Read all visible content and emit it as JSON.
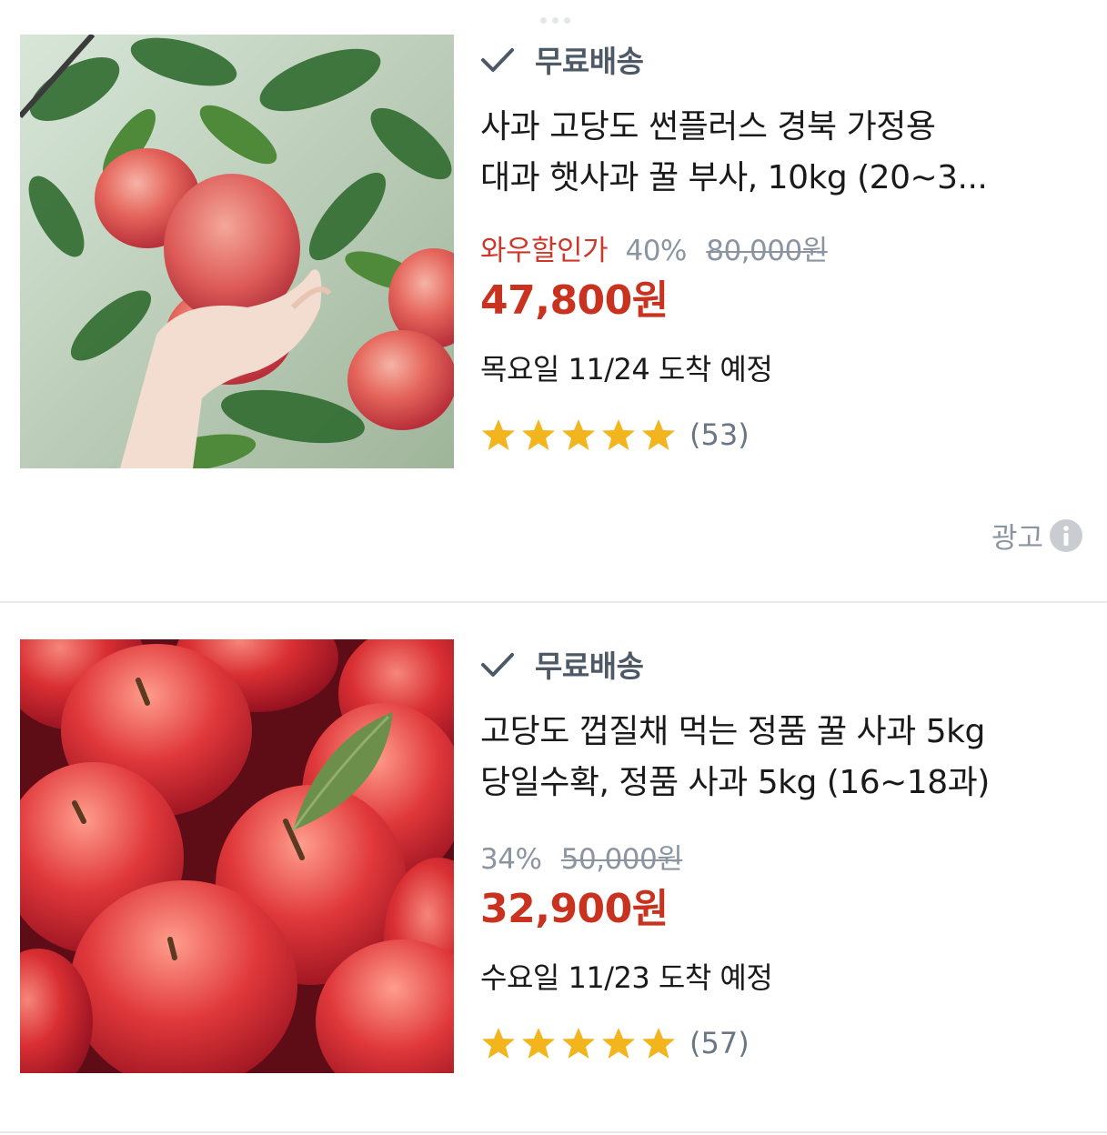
{
  "products": [
    {
      "free_shipping": "무료배송",
      "title_line1": "사과 고당도 썬플러스 경북 가정용",
      "title_line2": "대과 햇사과 꿀 부사, 10kg (20~3...",
      "discount_label": "와우할인가",
      "discount_percent": "40%",
      "original_price": "80,000원",
      "sale_price": "47,800원",
      "arrival": "목요일 11/24 도착 예정",
      "rating_stars": 5,
      "review_count": "(53)",
      "ad_label": "광고",
      "thumbnail_icon": "apple-tree-photo"
    },
    {
      "free_shipping": "무료배송",
      "title_line1": "고당도 껍질채 먹는 정품 꿀 사과 5kg",
      "title_line2": "당일수확, 정품 사과 5kg (16~18과)",
      "discount_percent": "34%",
      "original_price": "50,000원",
      "sale_price": "32,900원",
      "arrival": "수요일 11/23 도착 예정",
      "rating_stars": 5,
      "review_count": "(57)",
      "thumbnail_icon": "apple-pile-photo"
    }
  ],
  "colors": {
    "sale_red": "#c8321f",
    "wow_red": "#d0372b",
    "star_yellow": "#f3b51d",
    "muted_gray": "#8b95a1"
  }
}
